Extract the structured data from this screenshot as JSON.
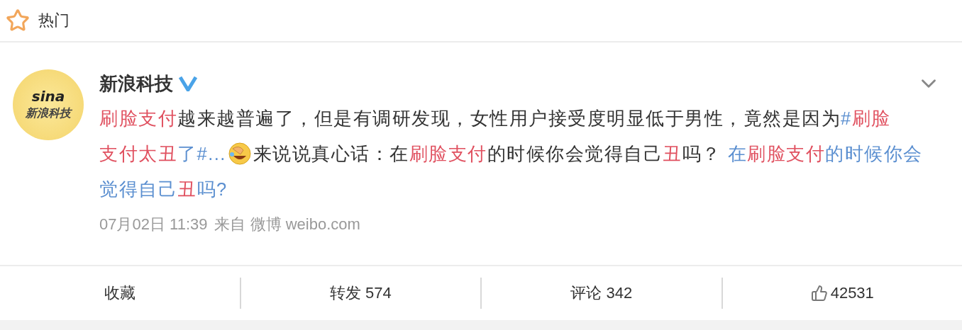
{
  "header": {
    "title": "热门"
  },
  "post": {
    "avatar": {
      "logo": "sina",
      "caption": "新浪科技"
    },
    "author": "新浪科技",
    "verified": true,
    "text_lines": [
      [
        {
          "kind": "keyword",
          "text": "刷脸支付"
        },
        {
          "kind": "plain",
          "text": "越来越普遍了，但是有调研发现，女性用户接受度明显低于男性，竟然是因为"
        },
        {
          "kind": "topic",
          "text": "#"
        },
        {
          "kind": "keyword",
          "text": "刷脸"
        }
      ],
      [
        {
          "kind": "keyword",
          "text": "支付太丑"
        },
        {
          "kind": "topic",
          "text": "了#..."
        },
        {
          "kind": "emoji"
        },
        {
          "kind": "plain",
          "text": "来说说真心话：在"
        },
        {
          "kind": "keyword",
          "text": "刷脸支付"
        },
        {
          "kind": "plain",
          "text": "的时候你会觉得自己"
        },
        {
          "kind": "keyword",
          "text": "丑"
        },
        {
          "kind": "plain",
          "text": "吗？ "
        },
        {
          "kind": "topic",
          "text": "在"
        },
        {
          "kind": "keyword",
          "text": "刷脸支付"
        },
        {
          "kind": "topic",
          "text": "的时候你会"
        }
      ],
      [
        {
          "kind": "topic",
          "text": "觉得自己"
        },
        {
          "kind": "keyword",
          "text": "丑"
        },
        {
          "kind": "topic",
          "text": "吗?"
        }
      ]
    ],
    "time": "07月02日 11:39",
    "source": "来自 微博 weibo.com"
  },
  "actions": [
    {
      "kind": "text",
      "label": "收藏"
    },
    {
      "kind": "text",
      "label": "转发 574"
    },
    {
      "kind": "text",
      "label": "评论 342"
    },
    {
      "kind": "like",
      "label": "42531"
    }
  ]
}
